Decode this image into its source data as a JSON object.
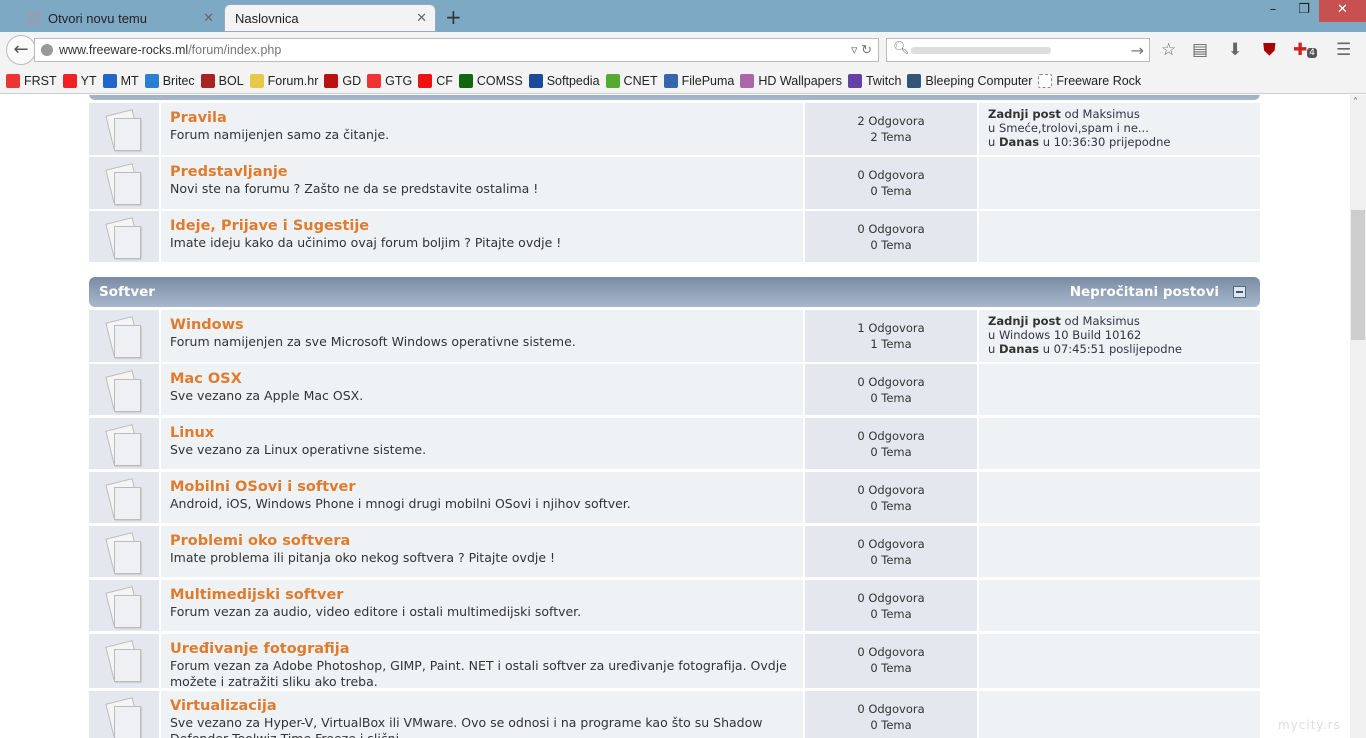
{
  "browser": {
    "tabs": [
      {
        "label": "Otvori novu temu",
        "active": false
      },
      {
        "label": "Naslovnica",
        "active": true
      }
    ],
    "url_host": "www.freeware-rocks.ml",
    "url_path": "/forum/index.php",
    "bookmarks": [
      {
        "label": "FRST",
        "color": "#e33"
      },
      {
        "label": "YT",
        "color": "#e22"
      },
      {
        "label": "MT",
        "color": "#2266cc"
      },
      {
        "label": "Britec",
        "color": "#2a7fd0"
      },
      {
        "label": "BOL",
        "color": "#a22"
      },
      {
        "label": "Forum.hr",
        "color": "#e8c84a"
      },
      {
        "label": "GD",
        "color": "#b11"
      },
      {
        "label": "GTG",
        "color": "#e33"
      },
      {
        "label": "CF",
        "color": "#e11"
      },
      {
        "label": "COMSS",
        "color": "#161"
      },
      {
        "label": "Softpedia",
        "color": "#1a4a9a"
      },
      {
        "label": "CNET",
        "color": "#5a3"
      },
      {
        "label": "FilePuma",
        "color": "#36a"
      },
      {
        "label": "HD Wallpapers",
        "color": "#a6a"
      },
      {
        "label": "Twitch",
        "color": "#6441a4"
      },
      {
        "label": "Bleeping Computer",
        "color": "#357"
      },
      {
        "label": "Freeware Rock",
        "color": "#fff"
      }
    ],
    "badge_count": "4"
  },
  "sections": [
    {
      "title": "",
      "forums": [
        {
          "name": "Pravila",
          "desc": "Forum namijenjen samo za čitanje.",
          "replies": "2 Odgovora",
          "topics": "2 Tema",
          "last": {
            "label": "Zadnji post",
            "by": "od Maksimus",
            "in": "u Smeće,trolovi,spam i ne...",
            "when_prefix": "u",
            "when_day": "Danas",
            "when_time": "u 10:36:30 prijepodne"
          }
        },
        {
          "name": "Predstavljanje",
          "desc": "Novi ste na forumu ? Zašto ne da se predstavite ostalima !",
          "replies": "0 Odgovora",
          "topics": "0 Tema"
        },
        {
          "name": "Ideje, Prijave i Sugestije",
          "desc": "Imate ideju kako da učinimo ovaj forum boljim ? Pitajte ovdje !",
          "replies": "0 Odgovora",
          "topics": "0 Tema"
        }
      ]
    },
    {
      "title": "Softver",
      "unread": "Nepročitani postovi",
      "forums": [
        {
          "name": "Windows",
          "desc": "Forum namijenjen za sve Microsoft Windows operativne sisteme.",
          "replies": "1 Odgovora",
          "topics": "1 Tema",
          "last": {
            "label": "Zadnji post",
            "by": "od Maksimus",
            "in": "u Windows 10 Build 10162",
            "when_prefix": "u",
            "when_day": "Danas",
            "when_time": "u 07:45:51 poslijepodne"
          }
        },
        {
          "name": "Mac OSX",
          "desc": "Sve vezano za Apple Mac OSX.",
          "replies": "0 Odgovora",
          "topics": "0 Tema"
        },
        {
          "name": "Linux",
          "desc": "Sve vezano za Linux operativne sisteme.",
          "replies": "0 Odgovora",
          "topics": "0 Tema"
        },
        {
          "name": "Mobilni OSovi i softver",
          "desc": "Android, iOS, Windows Phone i mnogi drugi mobilni OSovi i njihov softver.",
          "replies": "0 Odgovora",
          "topics": "0 Tema"
        },
        {
          "name": "Problemi oko softvera",
          "desc": "Imate problema ili pitanja oko nekog softvera ? Pitajte ovdje !",
          "replies": "0 Odgovora",
          "topics": "0 Tema"
        },
        {
          "name": "Multimedijski softver",
          "desc": "Forum vezan za audio, video editore i ostali multimedijski softver.",
          "replies": "0 Odgovora",
          "topics": "0 Tema"
        },
        {
          "name": "Uređivanje fotografija",
          "desc": "Forum vezan za Adobe Photoshop, GIMP, Paint. NET i ostali softver za uređivanje fotografija. Ovdje možete i zatražiti sliku ako treba.",
          "replies": "0 Odgovora",
          "topics": "0 Tema"
        },
        {
          "name": "Virtualizacija",
          "desc": "Sve vezano za Hyper-V, VirtualBox ili VMware. Ovo se odnosi i na programe kao što su Shadow Defender,Toolwiz Time Freeze i slični.",
          "replies": "0 Odgovora",
          "topics": "0 Tema"
        }
      ]
    }
  ],
  "watermark": "mycity.rs"
}
